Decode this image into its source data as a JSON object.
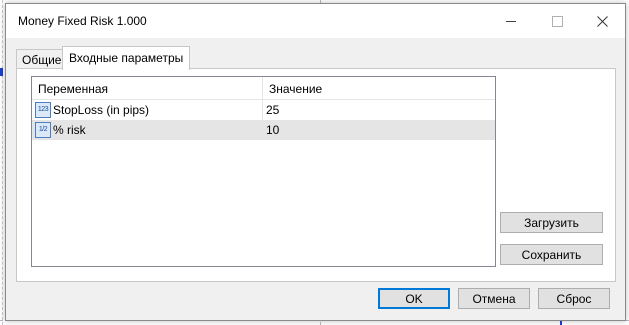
{
  "window": {
    "title": "Money Fixed Risk 1.000"
  },
  "tabs": [
    {
      "label": "Общие",
      "active": false
    },
    {
      "label": "Входные параметры",
      "active": true
    }
  ],
  "grid": {
    "columns": [
      "Переменная",
      "Значение"
    ],
    "rows": [
      {
        "icon": "number-type-icon",
        "icon_text": "123",
        "name": "StopLoss (in pips)",
        "value": "25",
        "selected": false
      },
      {
        "icon": "fraction-type-icon",
        "icon_text": "1/2",
        "name": "% risk",
        "value": "10",
        "selected": true
      }
    ]
  },
  "side_buttons": {
    "load": "Загрузить",
    "save": "Сохранить"
  },
  "footer_buttons": {
    "ok": "OK",
    "cancel": "Отмена",
    "reset": "Сброс"
  },
  "colors": {
    "accent": "#0078d7",
    "selected_row": "#e5e5e5",
    "dialog_bg": "#f0f0f0",
    "chart_marker": "#1a3fd6"
  }
}
